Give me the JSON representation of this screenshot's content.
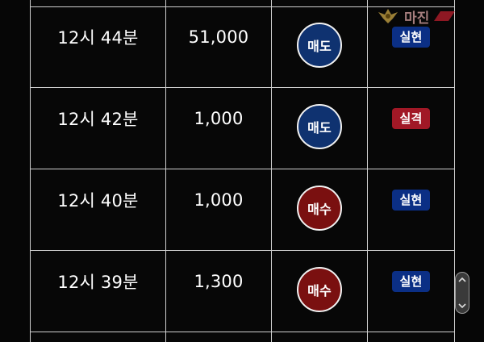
{
  "rows": [
    {
      "time": "12시 44분",
      "amount": "51,000",
      "action": "매도",
      "action_type": "sell",
      "result": "실현",
      "result_type": "real"
    },
    {
      "time": "12시 42분",
      "amount": "1,000",
      "action": "매도",
      "action_type": "sell",
      "result": "실격",
      "result_type": "fail"
    },
    {
      "time": "12시 40분",
      "amount": "1,000",
      "action": "매수",
      "action_type": "buy",
      "result": "실현",
      "result_type": "real"
    },
    {
      "time": "12시 39분",
      "amount": "1,300",
      "action": "매수",
      "action_type": "buy",
      "result": "실현",
      "result_type": "real"
    }
  ],
  "watermark": {
    "text": "마진"
  },
  "colors": {
    "sell": "#0f3270",
    "buy": "#7a1010",
    "real": "#0b2f85",
    "fail": "#a11826",
    "grid": "#cfcfcf",
    "background": "#060606"
  },
  "icons": {
    "scroll_up": "chevron-up-icon",
    "scroll_down": "chevron-down-icon",
    "logo": "eagle-emblem-icon"
  }
}
